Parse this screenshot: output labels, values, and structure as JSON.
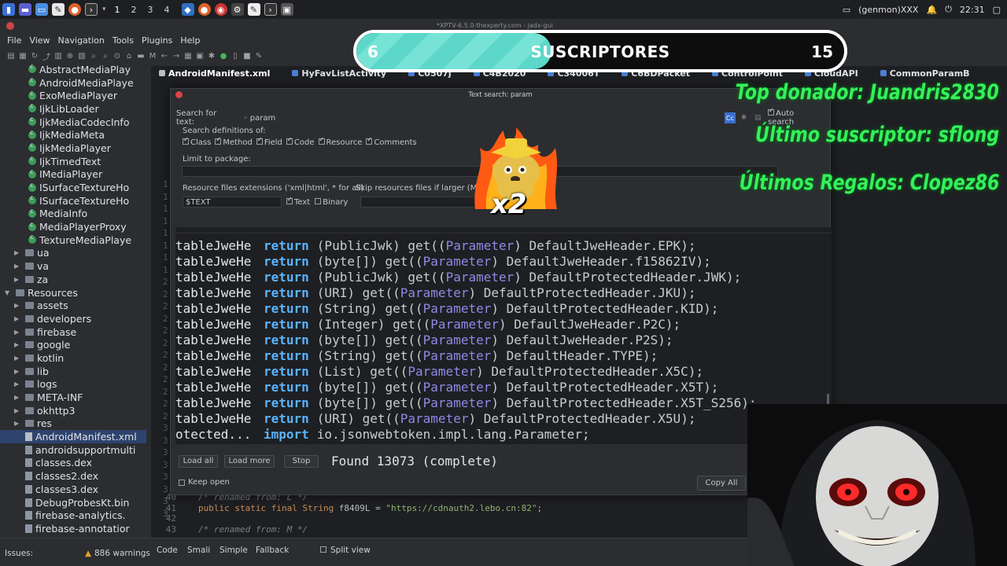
{
  "taskbar": {
    "workspaces": [
      "1",
      "2",
      "3",
      "4"
    ],
    "user": "(genmon)XXX",
    "clock": "22:31"
  },
  "window": {
    "title": "*XPTV-6.5.0-thexperty.com - jadx-gui"
  },
  "menu": [
    "File",
    "View",
    "Navigation",
    "Tools",
    "Plugins",
    "Help"
  ],
  "tree": {
    "classes": [
      "AbstractMediaPlay",
      "AndroidMediaPlaye",
      "ExoMediaPlayer",
      "IjkLibLoader",
      "IjkMediaCodecInfo",
      "IjkMediaMeta",
      "IjkMediaPlayer",
      "IjkTimedText",
      "IMediaPlayer",
      "ISurfaceTextureHo",
      "ISurfaceTextureHo",
      "MediaInfo",
      "MediaPlayerProxy",
      "TextureMediaPlaye"
    ],
    "packages": [
      "ua",
      "va",
      "za"
    ],
    "resources_label": "Resources",
    "resource_folders": [
      "assets",
      "developers",
      "firebase",
      "google",
      "kotlin",
      "lib",
      "logs",
      "META-INF",
      "okhttp3",
      "res"
    ],
    "resource_files": [
      "AndroidManifest.xml",
      "androidsupportmulti",
      "classes.dex",
      "classes2.dex",
      "classes3.dex",
      "DebugProbesKt.bin",
      "firebase-analytics.",
      "firebase-annotatior"
    ],
    "selected": "AndroidManifest.xml"
  },
  "tabs": [
    "AndroidManifest.xml",
    "HyFavListActivity",
    "C0507j",
    "C4B2020",
    "C34006T",
    "C6BDPacket",
    "ControlPoint",
    "CloudAPI",
    "CommonParamB"
  ],
  "gutter_numbers": [
    "1",
    "1",
    "1",
    "1",
    "1",
    "1",
    "1",
    "1",
    "2",
    "2",
    "2",
    "2",
    "2",
    "2",
    "2",
    "2",
    "2",
    "2",
    "2",
    "2",
    "3",
    "3",
    "3",
    "3",
    "3",
    "3",
    "3",
    "3"
  ],
  "dialog": {
    "title": "Text search: param",
    "search_label": "Search for text:",
    "search_value": "param",
    "auto_search": "Auto search",
    "case_btn": "Cc",
    "definitions_label": "Search definitions of:",
    "definitions": [
      {
        "label": "Class",
        "checked": true
      },
      {
        "label": "Method",
        "checked": true
      },
      {
        "label": "Field",
        "checked": true
      },
      {
        "label": "Code",
        "checked": true
      },
      {
        "label": "Resource",
        "checked": true
      },
      {
        "label": "Comments",
        "checked": true
      }
    ],
    "package_label": "Limit to package:",
    "resext_label": "Resource files extensions ('xml|html', * for all)",
    "resext_value": "$TEXT",
    "text_label": "Text",
    "binary_label": "Binary",
    "skip_label": "Skip resources files if larger (MB)",
    "results": [
      {
        "prefix": "tableJweHe",
        "code": "(PublicJwk) get((Parameter) DefaultJweHeader.EPK);"
      },
      {
        "prefix": "tableJweHe",
        "code": "(byte[]) get((Parameter) DefaultJweHeader.f15862IV);"
      },
      {
        "prefix": "tableJweHe",
        "code": "(PublicJwk) get((Parameter) DefaultProtectedHeader.JWK);"
      },
      {
        "prefix": "tableJweHe",
        "code": "(URI) get((Parameter) DefaultProtectedHeader.JKU);"
      },
      {
        "prefix": "tableJweHe",
        "code": "(String) get((Parameter) DefaultProtectedHeader.KID);"
      },
      {
        "prefix": "tableJweHe",
        "code": "(Integer) get((Parameter) DefaultJweHeader.P2C);"
      },
      {
        "prefix": "tableJweHe",
        "code": "(byte[]) get((Parameter) DefaultJweHeader.P2S);"
      },
      {
        "prefix": "tableJweHe",
        "code": "(String) get((Parameter) DefaultHeader.TYPE);"
      },
      {
        "prefix": "tableJweHe",
        "code": "(List) get((Parameter) DefaultProtectedHeader.X5C);"
      },
      {
        "prefix": "tableJweHe",
        "code": "(byte[]) get((Parameter) DefaultProtectedHeader.X5T);"
      },
      {
        "prefix": "tableJweHe",
        "code": "(byte[]) get((Parameter) DefaultProtectedHeader.X5T_S256);"
      },
      {
        "prefix": "tableJweHe",
        "code": "(URI) get((Parameter) DefaultProtectedHeader.X5U);"
      }
    ],
    "import_rows": [
      {
        "prefix": "otected...",
        "kw": "import",
        "code": "io.jsonwebtoken.impl.lang.Parameter;"
      },
      {
        "prefix": "otected...",
        "kw": "import",
        "code": "io.jsonwebtoken.impl.lang.Parameters;"
      }
    ],
    "return_kw": "return",
    "load_all": "Load all",
    "load_more": "Load more",
    "stop": "Stop",
    "found": "Found 13073 (complete)",
    "keep_open": "Keep open",
    "copy_all": "Copy All"
  },
  "code_bottom": [
    {
      "n": "40",
      "text": "/* renamed from: L */"
    },
    {
      "n": "41",
      "kw": "public static final String",
      "name": " f8409L = ",
      "str": "\"https://cdnauth2.lebo.cn:82\"",
      "end": ";"
    },
    {
      "n": "42",
      "text": ""
    },
    {
      "n": "43",
      "text": "/* renamed from: M */"
    }
  ],
  "status": {
    "issues": "Issues:",
    "warnings": "886 warnings",
    "views": [
      "Code",
      "Smali",
      "Simple",
      "Fallback"
    ],
    "split": "Split view"
  },
  "overlay": {
    "sub_current": "6",
    "sub_label": "SUSCRIPTORES",
    "sub_goal": "15",
    "sub_progress": 0.4,
    "top_donor": "Top donador: Juandris2830",
    "last_sub": "Último suscriptor: sflong",
    "last_gifts": "Últimos Regalos: Clopez86",
    "badge": "x2"
  },
  "colors": {
    "keyword_return": "#59b4ff",
    "highlight": "#8e8ae8",
    "neon": "#35f05a",
    "sub_fill": "#5cd7c9"
  }
}
